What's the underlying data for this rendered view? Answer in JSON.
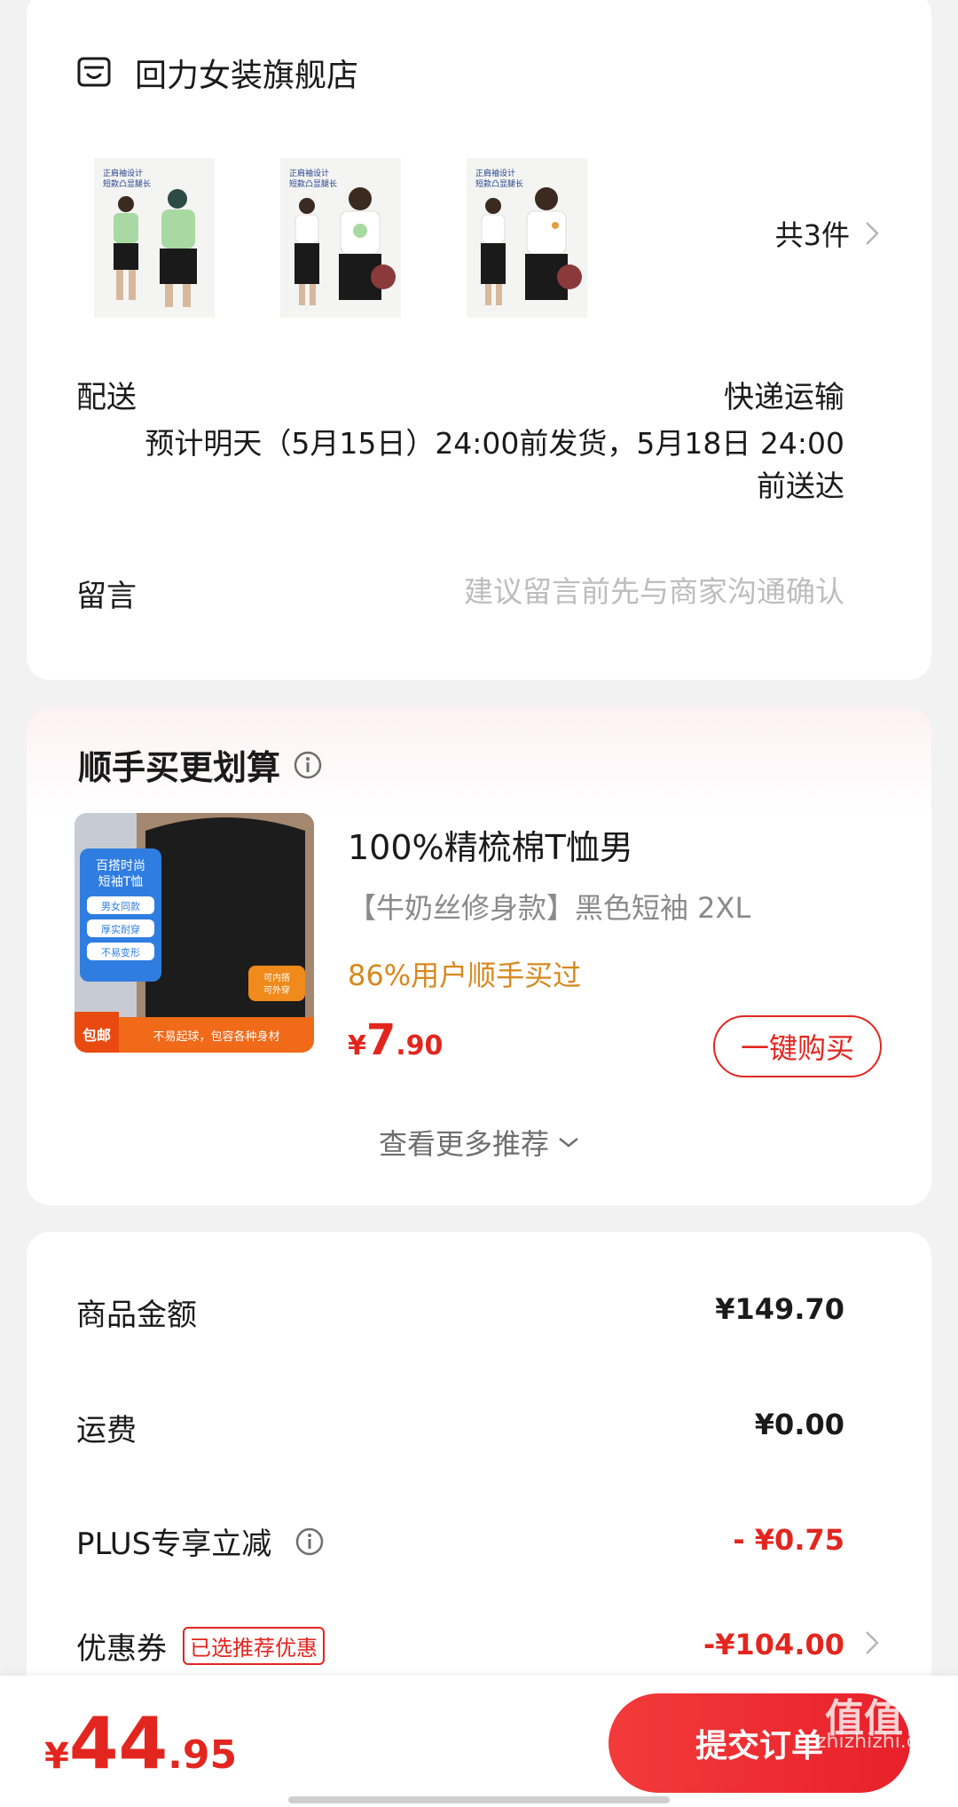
{
  "store": {
    "icon": "store-icon",
    "name": "回力女装旗舰店",
    "items_count": "共3件",
    "shipping_label": "配送",
    "shipping_method": "快递运输",
    "shipping_estimate": "预计明天（5月15日）24:00前发货，5月18日 24:00前送达",
    "message_label": "留言",
    "message_placeholder": "建议留言前先与商家沟通确认",
    "thumbnail_caption": "正肩袖设计 短款凸显腿长"
  },
  "recommend": {
    "title": "顺手买更划算",
    "product_name": "100%精梳棉T恤男",
    "spec": "【牛奶丝修身款】黑色短袖   2XL",
    "social_proof": "86%用户顺手买过",
    "price_currency": "¥",
    "price_int": "7",
    "price_dec": ".90",
    "buy_label": "一键购买",
    "more_label": "查看更多推荐",
    "image_texts": {
      "tag_title": "百搭时尚 短袖T恤",
      "tag1": "男女同款",
      "tag2": "厚实耐穿",
      "tag3": "不易变形",
      "side_tag": "可内搭 可外穿",
      "free_ship": "包邮",
      "bottom": "不易起球，包容各种身材"
    }
  },
  "pricing": {
    "goods_label": "商品金额",
    "goods_value": "¥149.70",
    "shipping_fee_label": "运费",
    "shipping_fee_value": "¥0.00",
    "plus_label": "PLUS专享立减",
    "plus_value": "- ¥0.75",
    "coupon_label": "优惠券",
    "coupon_tag": "已选推荐优惠",
    "coupon_value": "-¥104.00"
  },
  "bottom": {
    "total_currency": "¥",
    "total_int": "44",
    "total_dec": ".95",
    "submit_label": "提交订单"
  },
  "watermark": {
    "logo": "值值值",
    "site": "zhizhizhi.com"
  },
  "colors": {
    "accent_red": "#e2261f",
    "social_orange": "#d6891f",
    "background": "#f2f2f2"
  }
}
